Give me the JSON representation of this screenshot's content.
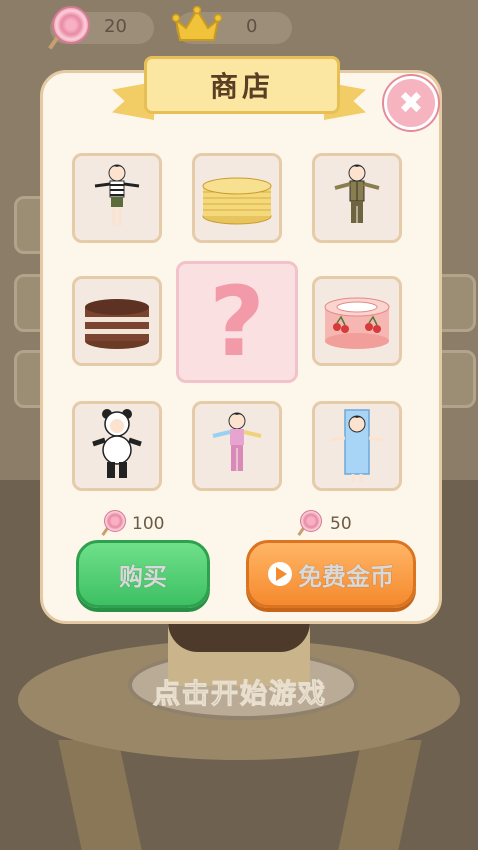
{
  "topbar": {
    "lollipop_count": "20",
    "crown_count": "0"
  },
  "background": {
    "start_text": "点击开始游戏"
  },
  "shop": {
    "title": "商店",
    "close_symbol": "✖",
    "items": [
      {
        "name": "striped-shirt-outfit"
      },
      {
        "name": "pancake-stack"
      },
      {
        "name": "khaki-uniform-outfit"
      },
      {
        "name": "chocolate-layer-cake"
      },
      {
        "name": "mystery-item",
        "symbol": "?"
      },
      {
        "name": "cherry-roll-cake"
      },
      {
        "name": "panda-costume-outfit"
      },
      {
        "name": "rainbow-pajama-outfit"
      },
      {
        "name": "milk-carton-costume-outfit"
      }
    ],
    "buy_price": "100",
    "free_price": "50",
    "buy_label": "购买",
    "free_coins_label": "免费金币"
  },
  "colors": {
    "buy_green": "#3ec063",
    "free_orange": "#f58a2e",
    "dialog_bg": "#fdf6ea",
    "ribbon_gold": "#fbe6a2"
  }
}
